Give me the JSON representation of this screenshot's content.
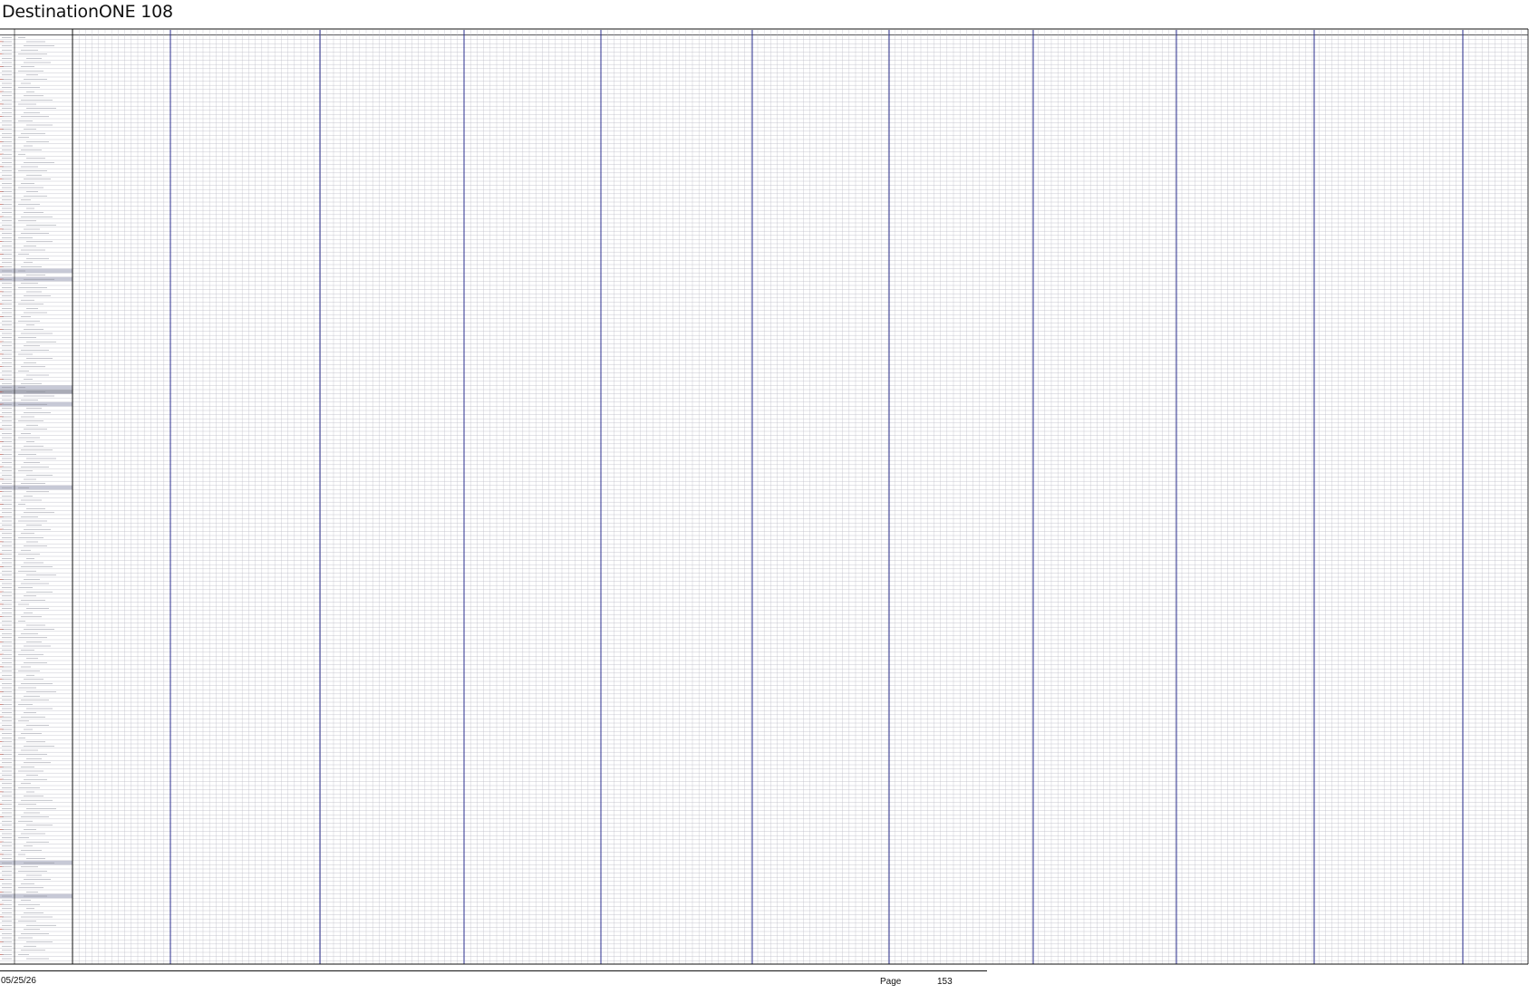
{
  "document": {
    "title": "DestinationONE 108"
  },
  "footer": {
    "date": "05/25/26",
    "page_label": "Page",
    "page_number": "153"
  },
  "colors": {
    "grid_line": "#b9b9c4",
    "section_divider": "#2b2f8f",
    "group_band": "#c7c9d6",
    "header_band": "#a9abb6",
    "frame": "#111111",
    "row_tick": "#c0392b"
  }
}
